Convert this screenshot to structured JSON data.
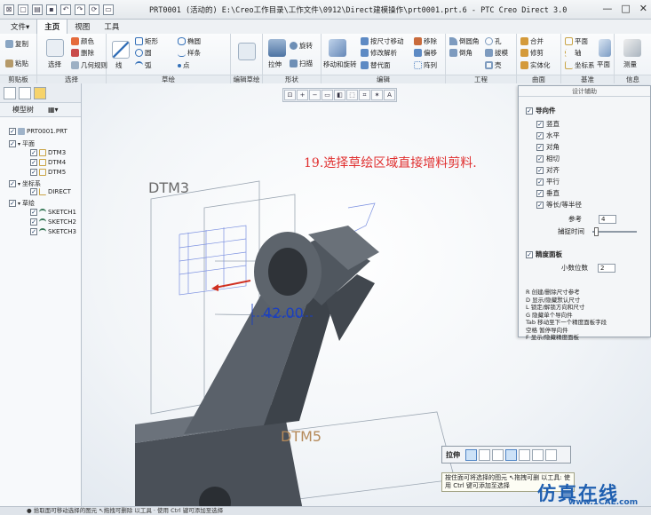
{
  "title": "PRT0001 (活动的) E:\\Creo工作目录\\工作文件\\0912\\Direct建模操作\\prt0001.prt.6 - PTC Creo Direct 3.0",
  "window_buttons": [
    "—",
    "□",
    "✕"
  ],
  "tabs": [
    "文件▾",
    "主页",
    "视图",
    "工具"
  ],
  "ribbon": {
    "clipboard": {
      "label": "剪贴板",
      "items": [
        "复制",
        "粘贴"
      ]
    },
    "select": {
      "label": "选择",
      "items": [
        "选择",
        "颜色",
        "删除",
        "几何规则"
      ]
    },
    "sketch": {
      "label": "草绘",
      "items": [
        "线",
        "矩形",
        "圆",
        "弧",
        "椭圆",
        "样条",
        "点"
      ]
    },
    "sketch_edit": {
      "label": "编辑草绘",
      "items": []
    },
    "shape": {
      "label": "形状",
      "items": [
        "拉伸",
        "旋转",
        "扫描"
      ]
    },
    "edit": {
      "label": "编辑",
      "items": [
        "移动和旋转",
        "按尺寸移动",
        "修改解析",
        "替代面",
        "移除",
        "偏移",
        "阵列"
      ]
    },
    "engineering": {
      "label": "工程",
      "items": [
        "倒圆角",
        "倒角",
        "孔",
        "拔模",
        "壳"
      ]
    },
    "surface": {
      "label": "曲面",
      "items": [
        "合并",
        "修剪",
        "实体化"
      ]
    },
    "datum": {
      "label": "基准",
      "items": [
        "平面",
        "轴",
        "坐标系",
        "平面"
      ]
    },
    "measure": {
      "label": "信息",
      "items": [
        "测量"
      ]
    }
  },
  "model_tree": {
    "header": "模型树",
    "items": [
      {
        "label": "PRT0001.PRT",
        "level": 0
      },
      {
        "label": "平面",
        "level": 1
      },
      {
        "label": "DTM3",
        "level": 2
      },
      {
        "label": "DTM4",
        "level": 2
      },
      {
        "label": "DTM5",
        "level": 2
      },
      {
        "label": "坐标系",
        "level": 1
      },
      {
        "label": "DIRECT",
        "level": 2
      },
      {
        "label": "草绘",
        "level": 1
      },
      {
        "label": "SKETCH1",
        "level": 2
      },
      {
        "label": "SKETCH2",
        "level": 2
      },
      {
        "label": "SKETCH3",
        "level": 2
      }
    ]
  },
  "annotation": "19.选择草绘区域直接增料剪料.",
  "viewport_labels": {
    "dtm3": "DTM3",
    "dtm5": "DTM5",
    "dimension": "42.00"
  },
  "design_aid": {
    "title": "设计辅助",
    "guide_header": "导向件",
    "guides": [
      "竖直",
      "水平",
      "对角",
      "相切",
      "对齐",
      "平行",
      "垂直",
      "等长/等半径"
    ],
    "reference_label": "参考",
    "reference_value": "4",
    "snap_time_label": "捕捉时间",
    "precision_header": "精度面板",
    "decimal_label": "小数位数",
    "decimal_value": "2",
    "shortcuts": "R 创建/删除尺寸参考\nD 显示/隐藏默认尺寸\nL 锁定/解锁方向和尺寸\nG 隐藏单个导向件\nTab 移动至下一个精度面板字段\n空格 暂停导向件\nF 显示/隐藏精度面板"
  },
  "mini_toolbar": {
    "label": "拉伸"
  },
  "tooltip": "按住面可将选择的图元 ↖拖拽可删 以工具: 使用 Ctrl 键可添加至选择",
  "status": "● 拾取面可移动选择的图元 ↖拖拽可删除 以工具 · 使用 Ctrl 键可添加至选择",
  "watermark": {
    "main": "仿真在线",
    "sub": "www.1CAE.com"
  },
  "colors": {
    "annotation": "#e03030",
    "dimension": "#1a3fc0",
    "model": "#4e545c",
    "watermark": "#1f5fb0"
  }
}
